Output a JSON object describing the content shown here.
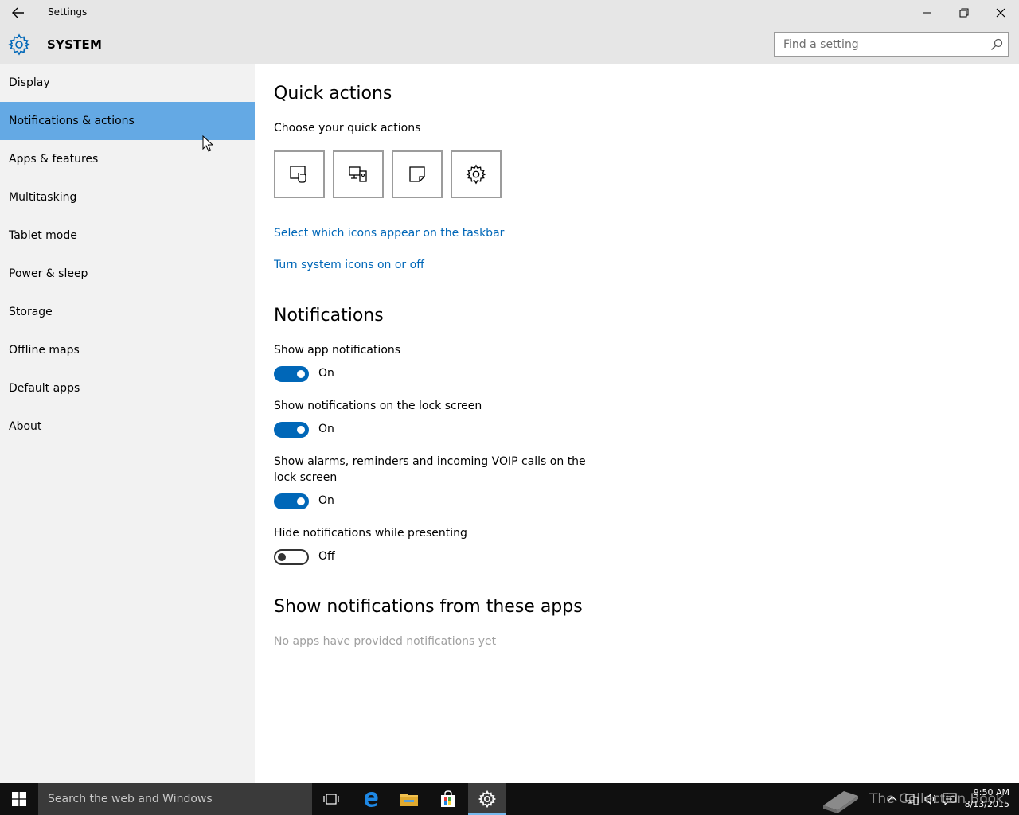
{
  "window": {
    "title": "Settings",
    "back_icon": "back-arrow-icon",
    "controls": [
      "minimize-icon",
      "restore-icon",
      "close-icon"
    ]
  },
  "header": {
    "section_title": "SYSTEM",
    "icon": "gear-icon",
    "search_placeholder": "Find a setting"
  },
  "sidebar": {
    "selected": "Notifications & actions",
    "items": [
      {
        "label": "Display"
      },
      {
        "label": "Notifications & actions"
      },
      {
        "label": "Apps & features"
      },
      {
        "label": "Multitasking"
      },
      {
        "label": "Tablet mode"
      },
      {
        "label": "Power & sleep"
      },
      {
        "label": "Storage"
      },
      {
        "label": "Offline maps"
      },
      {
        "label": "Default apps"
      },
      {
        "label": "About"
      }
    ]
  },
  "main": {
    "quick_actions": {
      "heading": "Quick actions",
      "subheading": "Choose your quick actions",
      "tiles": [
        "tablet-mode-icon",
        "connect-icon",
        "note-icon",
        "all-settings-icon"
      ],
      "links": [
        "Select which icons appear on the taskbar",
        "Turn system icons on or off"
      ]
    },
    "notifications": {
      "heading": "Notifications",
      "settings": [
        {
          "label": "Show app notifications",
          "state": "On",
          "on": true
        },
        {
          "label": "Show notifications on the lock screen",
          "state": "On",
          "on": true
        },
        {
          "label": "Show alarms, reminders and incoming VOIP calls on the lock screen",
          "state": "On",
          "on": true
        },
        {
          "label": "Hide notifications while presenting",
          "state": "Off",
          "on": false
        }
      ]
    },
    "apps": {
      "heading": "Show notifications from these apps",
      "empty_text": "No apps have provided notifications yet"
    }
  },
  "taskbar": {
    "search_placeholder": "Search the web and Windows",
    "watermark": "The Collection Book",
    "time": "9:50 AM",
    "date": "8/13/2015"
  },
  "colors": {
    "accent": "#0067b8",
    "sidebar_selected": "#64a9e4",
    "titlebar": "#e6e6e6",
    "sidebar_bg": "#f2f2f2",
    "taskbar": "#101010"
  }
}
